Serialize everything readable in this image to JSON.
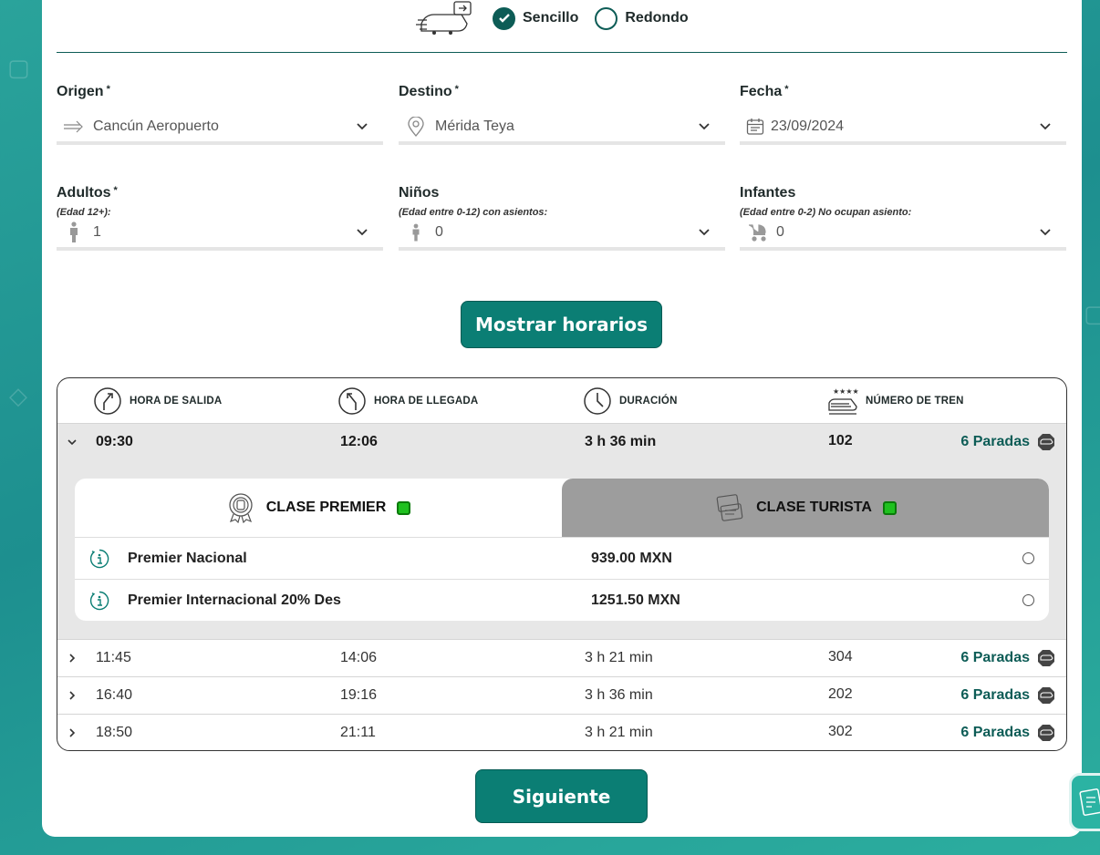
{
  "trip_type": {
    "one_way": "Sencillo",
    "round_trip": "Redondo",
    "selected": "one_way"
  },
  "form": {
    "origin": {
      "label": "Origen",
      "required": "*",
      "value": "Cancún Aeropuerto"
    },
    "destination": {
      "label": "Destino",
      "required": "*",
      "value": "Mérida Teya"
    },
    "date": {
      "label": "Fecha",
      "required": "*",
      "value": "23/09/2024"
    },
    "adults": {
      "label": "Adultos",
      "required": "*",
      "sub": "(Edad 12+):",
      "value": "1"
    },
    "children": {
      "label": "Niños",
      "sub": "(Edad entre 0-12) con asientos:",
      "value": "0"
    },
    "infants": {
      "label": "Infantes",
      "sub": "(Edad entre 0-2) No ocupan asiento:",
      "value": "0"
    }
  },
  "show_schedules_label": "Mostrar horarios",
  "schedule": {
    "headers": {
      "departure": "HORA DE SALIDA",
      "arrival": "HORA DE LLEGADA",
      "duration": "DURACIÓN",
      "train": "NÚMERO DE TREN"
    },
    "rows": [
      {
        "departure": "09:30",
        "arrival": "12:06",
        "duration": "3 h 36 min",
        "train": "102",
        "stops": "6 Paradas",
        "expanded": true
      },
      {
        "departure": "11:45",
        "arrival": "14:06",
        "duration": "3 h 21 min",
        "train": "304",
        "stops": "6 Paradas",
        "expanded": false
      },
      {
        "departure": "16:40",
        "arrival": "19:16",
        "duration": "3 h 36 min",
        "train": "202",
        "stops": "6 Paradas",
        "expanded": false
      },
      {
        "departure": "18:50",
        "arrival": "21:11",
        "duration": "3 h 21 min",
        "train": "302",
        "stops": "6 Paradas",
        "expanded": false
      }
    ],
    "classes": {
      "premier": "CLASE PREMIER",
      "tourist": "CLASE TURISTA",
      "active": "premier"
    },
    "fares": [
      {
        "name": "Premier Nacional",
        "price": "939.00 MXN"
      },
      {
        "name": "Premier Internacional 20% Des",
        "price": "1251.50 MXN"
      }
    ]
  },
  "next_label": "Siguiente",
  "colors": {
    "primary": "#0b7e74",
    "dark_teal": "#0d5c56",
    "badge_green": "#1fc11f"
  }
}
